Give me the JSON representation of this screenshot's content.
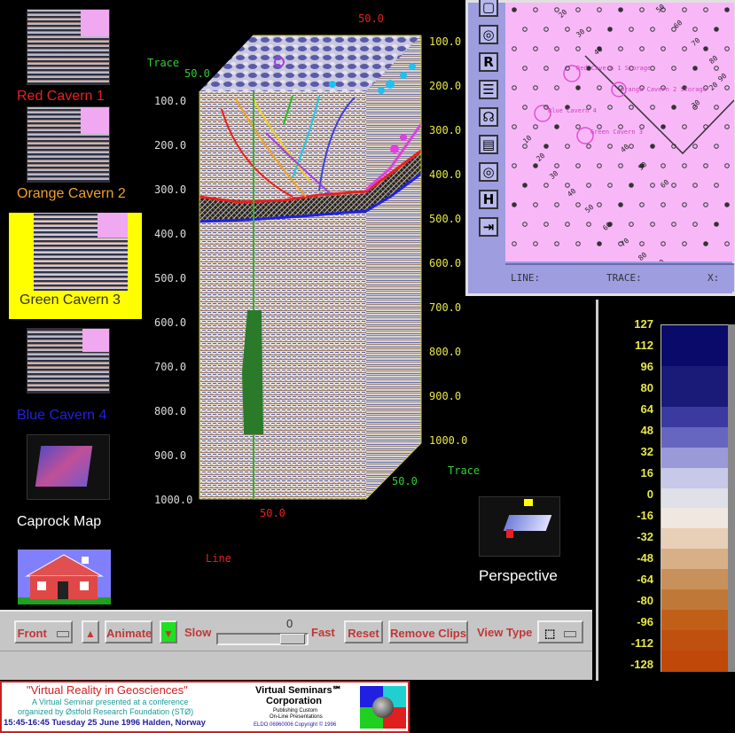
{
  "cavern_list": [
    {
      "label": "Red Cavern 1",
      "color": "#e82020"
    },
    {
      "label": "Orange Cavern 2",
      "color": "#f0a028"
    },
    {
      "label": "Green Cavern 3",
      "color": "#333333"
    },
    {
      "label": "Blue Cavern 4",
      "color": "#2020e0"
    },
    {
      "label": "Caprock Map",
      "color": "#ffffff"
    }
  ],
  "perspective_label": "Perspective",
  "cube": {
    "top_axis_label": "50.0",
    "trace_label_top": "Trace",
    "trace_label_bottom": "Trace",
    "top_left_value": "50.0",
    "bottom_front_value": "50.0",
    "bottom_right_value": "50.0",
    "line_label": "Line",
    "left_depths": [
      "100.0",
      "200.0",
      "300.0",
      "400.0",
      "500.0",
      "600.0",
      "700.0",
      "800.0",
      "900.0",
      "1000.0"
    ],
    "right_depths": [
      "100.0",
      "200.0",
      "300.0",
      "400.0",
      "500.0",
      "600.0",
      "700.0",
      "800.0",
      "900.0",
      "1000.0"
    ]
  },
  "toolbar": {
    "view_select": "Front",
    "animate": "Animate",
    "slow": "Slow",
    "speed_value": "0",
    "fast": "Fast",
    "reset": "Reset",
    "remove_clips": "Remove Clips",
    "view_type": "View Type"
  },
  "map_window": {
    "tools": [
      "",
      "",
      "R",
      "",
      "",
      "",
      "",
      "H",
      ""
    ],
    "status_line": "LINE:",
    "status_trace": "TRACE:",
    "status_x": "X:",
    "cavern_labels": [
      "Red Cavern 1 Storage",
      "Orange Cavern 2 Storage",
      "Blue Cavern 4",
      "Green Cavern 3"
    ],
    "grid_numbers": [
      "20",
      "30",
      "40",
      "50",
      "60",
      "70",
      "80",
      "90",
      "10",
      "20",
      "30",
      "40",
      "50",
      "60",
      "70",
      "80",
      "90",
      "50",
      "60",
      "40",
      "30",
      "20"
    ]
  },
  "colorbar": {
    "ticks": [
      "127",
      "112",
      "96",
      "80",
      "64",
      "48",
      "32",
      "16",
      "0",
      "-16",
      "-32",
      "-48",
      "-64",
      "-80",
      "-96",
      "-112",
      "-128"
    ],
    "bands": [
      "#0a0a6a",
      "#0a0a6a",
      "#1a1a78",
      "#1a1a78",
      "#3a3aa0",
      "#6666c0",
      "#9a9ad8",
      "#c8c8e8",
      "#e0e0e8",
      "#f0e8e0",
      "#e8d0b8",
      "#d8b088",
      "#c8905a",
      "#c07838",
      "#c06018",
      "#c05010",
      "#c04808"
    ]
  },
  "footer": {
    "title": "\"Virtual Reality in Geosciences\"",
    "line1": "A Virtual Seminar presented at a conference",
    "line2": "organized by Østfold Research Foundation (STØ)",
    "line3": "15:45-16:45 Tuesday 25 June 1996 Halden, Norway",
    "company1": "Virtual Seminars℠",
    "company2": "Corporation",
    "tag1": "Publishing Custom",
    "tag2": "On-Line Presentations",
    "copyright": "ELDO 06960006 Copyright © 1996"
  }
}
